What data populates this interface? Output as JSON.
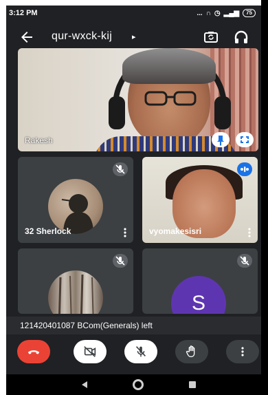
{
  "status_bar": {
    "time": "3:12 PM",
    "signal_text": "... ",
    "battery": "75"
  },
  "header": {
    "meeting_code": "qur-wxck-kij",
    "caret": "▸",
    "back_icon": "arrow-back-icon",
    "switch_camera_icon": "switch-camera-icon",
    "audio_icon": "headphones-icon"
  },
  "main_video": {
    "participant_name": "Rakesh",
    "pin_icon": "pin-icon",
    "fullscreen_icon": "fullscreen-icon"
  },
  "tiles": [
    {
      "name": "32 Sherlock",
      "muted": true
    },
    {
      "name": "vyomakesisri",
      "speaking": true
    },
    {
      "name": "",
      "muted": true
    },
    {
      "name": "",
      "avatar_letter": "S",
      "muted": true
    }
  ],
  "notice": {
    "text": "121420401087 BCom(Generals) left"
  },
  "controls": {
    "end_call_icon": "call-end-icon",
    "camera_icon": "videocam-off-icon",
    "mic_icon": "mic-off-icon",
    "hand_icon": "raise-hand-icon",
    "more_icon": "more-vert-icon"
  },
  "colors": {
    "end_call": "#ea4335",
    "tile_bg": "#3c4043",
    "avatar_s": "#5e35b1",
    "speaking": "#1a73e8"
  }
}
